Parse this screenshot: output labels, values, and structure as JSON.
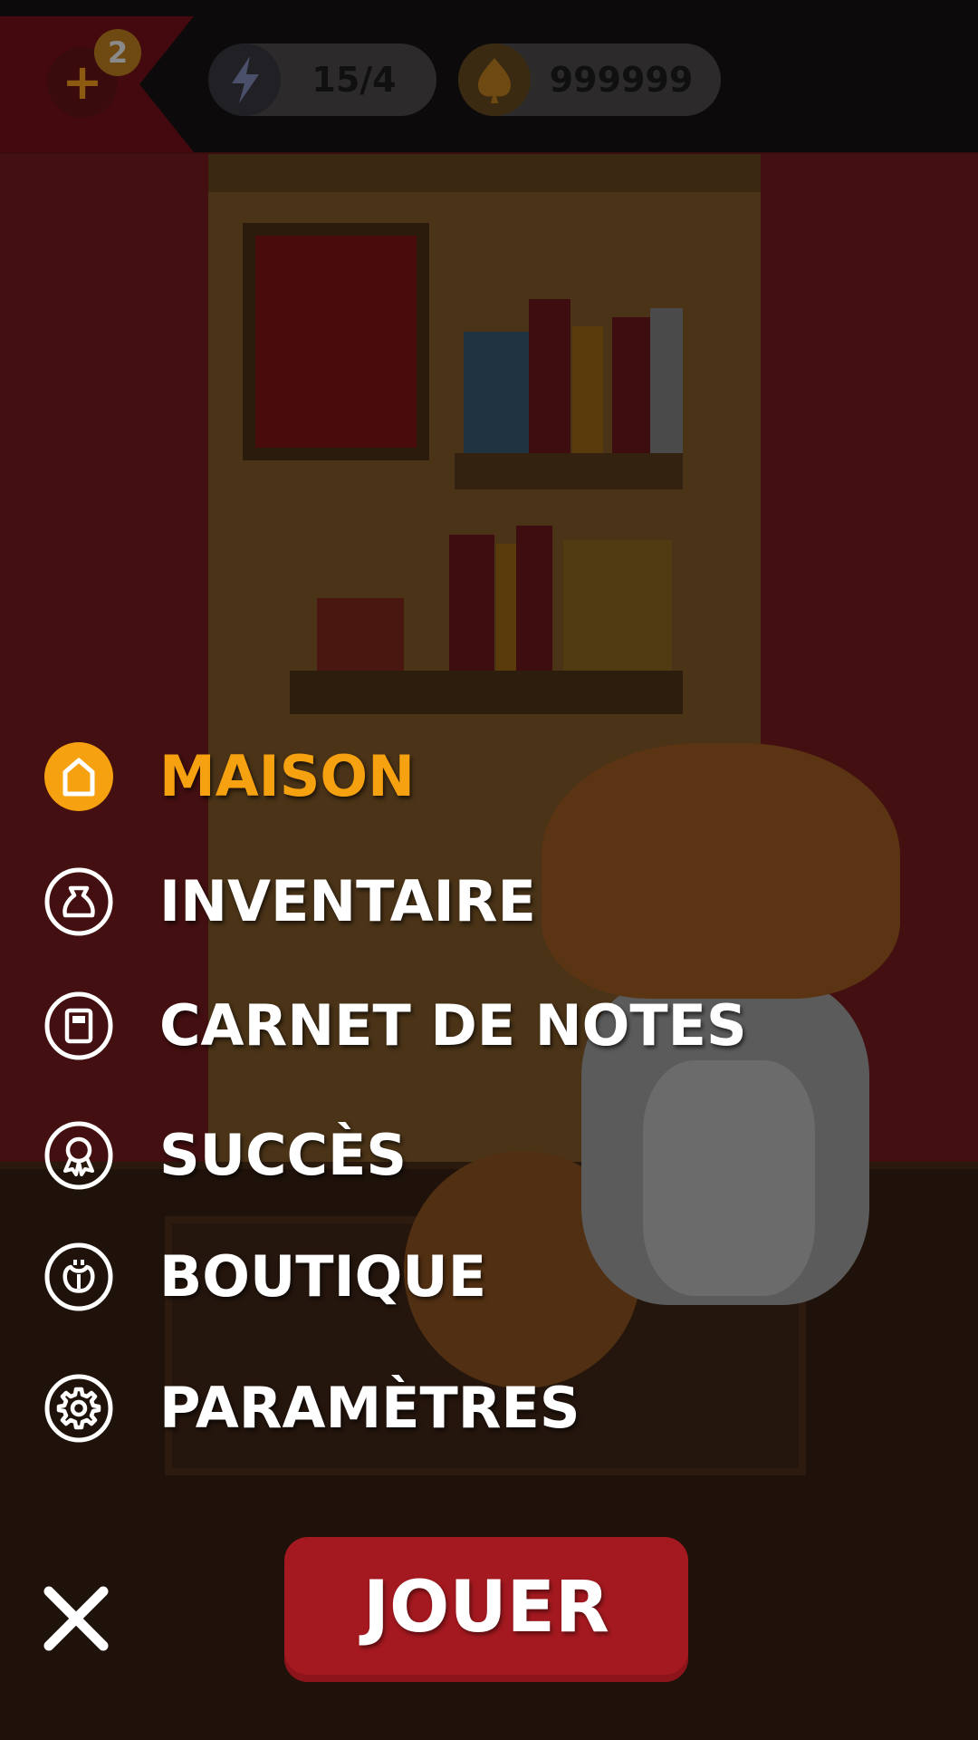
{
  "status_bar": {
    "plus_badge_count": "2",
    "energy": {
      "icon": "lightning-icon",
      "value": "15/4"
    },
    "coins": {
      "icon": "leaf-coin-icon",
      "value": "999999"
    }
  },
  "menu": {
    "items": [
      {
        "id": "maison",
        "label": "MAISON",
        "icon": "home-icon",
        "active": true
      },
      {
        "id": "inventaire",
        "label": "INVENTAIRE",
        "icon": "bag-icon",
        "active": false
      },
      {
        "id": "carnet",
        "label": "CARNET DE NOTES",
        "icon": "notebook-icon",
        "active": false
      },
      {
        "id": "succes",
        "label": "SUCCÈS",
        "icon": "award-icon",
        "active": false
      },
      {
        "id": "boutique",
        "label": "BOUTIQUE",
        "icon": "shop-icon",
        "active": false
      },
      {
        "id": "parametres",
        "label": "PARAMÈTRES",
        "icon": "gear-icon",
        "active": false
      }
    ]
  },
  "actions": {
    "play_label": "JOUER",
    "close_icon": "close-icon"
  },
  "colors": {
    "accent": "#f6a10f",
    "play_button": "#a3191f",
    "menu_text": "#ffffff"
  }
}
